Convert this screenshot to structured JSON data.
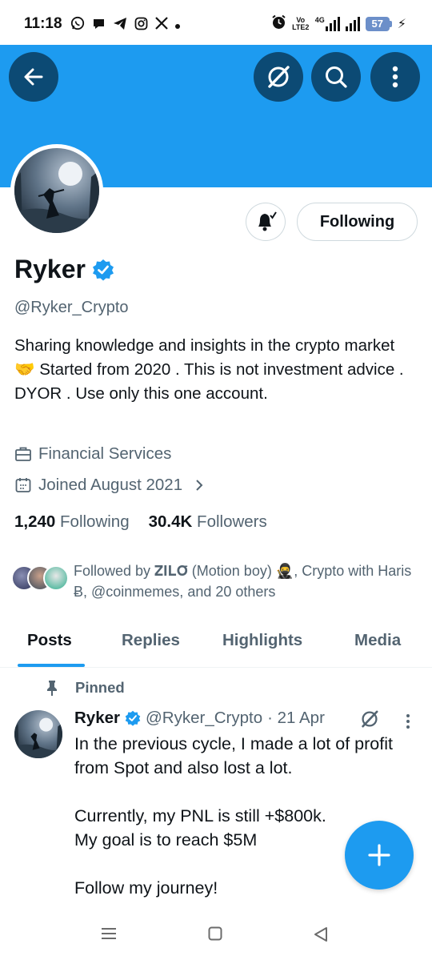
{
  "status_bar": {
    "time": "11:18",
    "app_icons": [
      "whatsapp-icon",
      "chat-icon",
      "telegram-icon",
      "instagram-icon",
      "x-icon",
      "dot"
    ],
    "volte": "Vo LTE2",
    "network": "4G",
    "battery": "57"
  },
  "header": {
    "back": "back-arrow-icon",
    "grok": "grok-icon",
    "search": "search-icon",
    "more": "more-vertical-icon",
    "banner_color": "#1d9bf0"
  },
  "profile": {
    "name": "Ryker",
    "handle": "@Ryker_Crypto",
    "bio": "Sharing knowledge and insights in the crypto market 🤝 Started from 2020 . This is not investment advice . DYOR . Use only this one account.",
    "category": "Financial Services",
    "joined": "Joined August 2021",
    "following_count": "1,240",
    "following_label": "Following",
    "followers_count": "30.4K",
    "followers_label": "Followers",
    "follow_button": "Following",
    "followed_by": "Followed by 𝐙𝐈𝐋𝐎̄ (Motion boy) 🥷, Crypto with Haris Ƀ, @coinmemes, and 20 others"
  },
  "tabs": [
    "Posts",
    "Replies",
    "Highlights",
    "Media"
  ],
  "active_tab": "Posts",
  "post": {
    "pinned_label": "Pinned",
    "author": "Ryker",
    "handle": "@Ryker_Crypto",
    "date": "· 21 Apr",
    "text": "In the previous cycle, I made a lot of profit from Spot and also lost a lot.\n\nCurrently, my PNL is still +$800k.\nMy goal is to reach $5M\n\nFollow my journey!"
  },
  "fab": "compose-plus-icon",
  "accent": "#1d9bf0"
}
